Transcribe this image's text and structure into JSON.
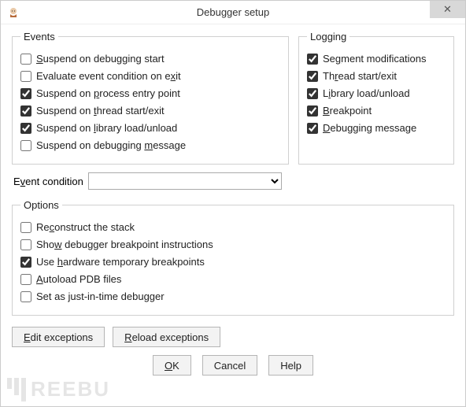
{
  "window": {
    "title": "Debugger setup",
    "close_glyph": "✕"
  },
  "events": {
    "legend": "Events",
    "items": [
      {
        "label_pre": "",
        "u": "S",
        "label_post": "uspend on debugging start",
        "checked": false
      },
      {
        "label_pre": "Evaluate event condition on e",
        "u": "x",
        "label_post": "it",
        "checked": false
      },
      {
        "label_pre": "Suspend on ",
        "u": "p",
        "label_post": "rocess entry point",
        "checked": true
      },
      {
        "label_pre": "Suspend on ",
        "u": "t",
        "label_post": "hread start/exit",
        "checked": true
      },
      {
        "label_pre": "Suspend on ",
        "u": "l",
        "label_post": "ibrary load/unload",
        "checked": true
      },
      {
        "label_pre": "Suspend on debugging ",
        "u": "m",
        "label_post": "essage",
        "checked": false
      }
    ]
  },
  "logging": {
    "legend": "Logging",
    "items": [
      {
        "label_pre": "Se",
        "u": "g",
        "label_post": "ment modifications",
        "checked": true
      },
      {
        "label_pre": "Th",
        "u": "r",
        "label_post": "ead start/exit",
        "checked": true
      },
      {
        "label_pre": "L",
        "u": "i",
        "label_post": "brary load/unload",
        "checked": true
      },
      {
        "label_pre": "",
        "u": "B",
        "label_post": "reakpoint",
        "checked": true
      },
      {
        "label_pre": "",
        "u": "D",
        "label_post": "ebugging message",
        "checked": true
      }
    ]
  },
  "event_condition": {
    "label_pre": "E",
    "u": "v",
    "label_post": "ent condition",
    "value": ""
  },
  "options": {
    "legend": "Options",
    "items": [
      {
        "label_pre": "Re",
        "u": "c",
        "label_post": "onstruct the stack",
        "checked": false
      },
      {
        "label_pre": "Sho",
        "u": "w",
        "label_post": " debugger breakpoint instructions",
        "checked": false
      },
      {
        "label_pre": "Use ",
        "u": "h",
        "label_post": "ardware temporary breakpoints",
        "checked": true
      },
      {
        "label_pre": "",
        "u": "A",
        "label_post": "utoload PDB files",
        "checked": false
      },
      {
        "label_pre": "Set as ",
        "u": "j",
        "label_post": "ust-in-time debugger",
        "checked": false
      }
    ]
  },
  "buttons": {
    "edit_exceptions_pre": "",
    "edit_exceptions_u": "E",
    "edit_exceptions_post": "dit exceptions",
    "reload_exceptions_pre": "",
    "reload_exceptions_u": "R",
    "reload_exceptions_post": "eload exceptions",
    "ok_pre": "",
    "ok_u": "O",
    "ok_post": "K",
    "cancel": "Cancel",
    "help": "Help"
  },
  "watermark": "REEBU"
}
